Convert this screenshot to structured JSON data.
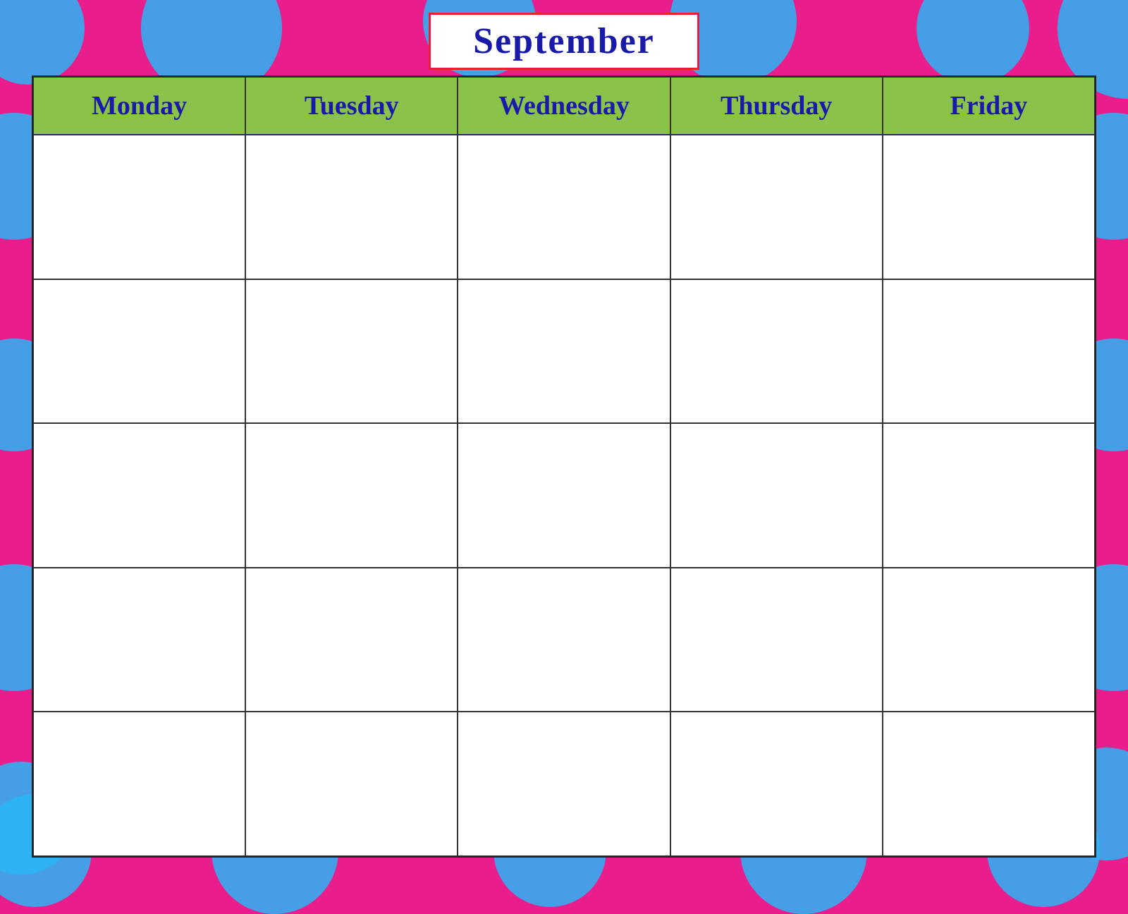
{
  "background": {
    "color": "#e91e8c",
    "dot_color": "#29b6f6"
  },
  "calendar": {
    "month": "September",
    "days": [
      "Monday",
      "Tuesday",
      "Wednesday",
      "Thursday",
      "Friday"
    ],
    "num_weeks": 5
  }
}
